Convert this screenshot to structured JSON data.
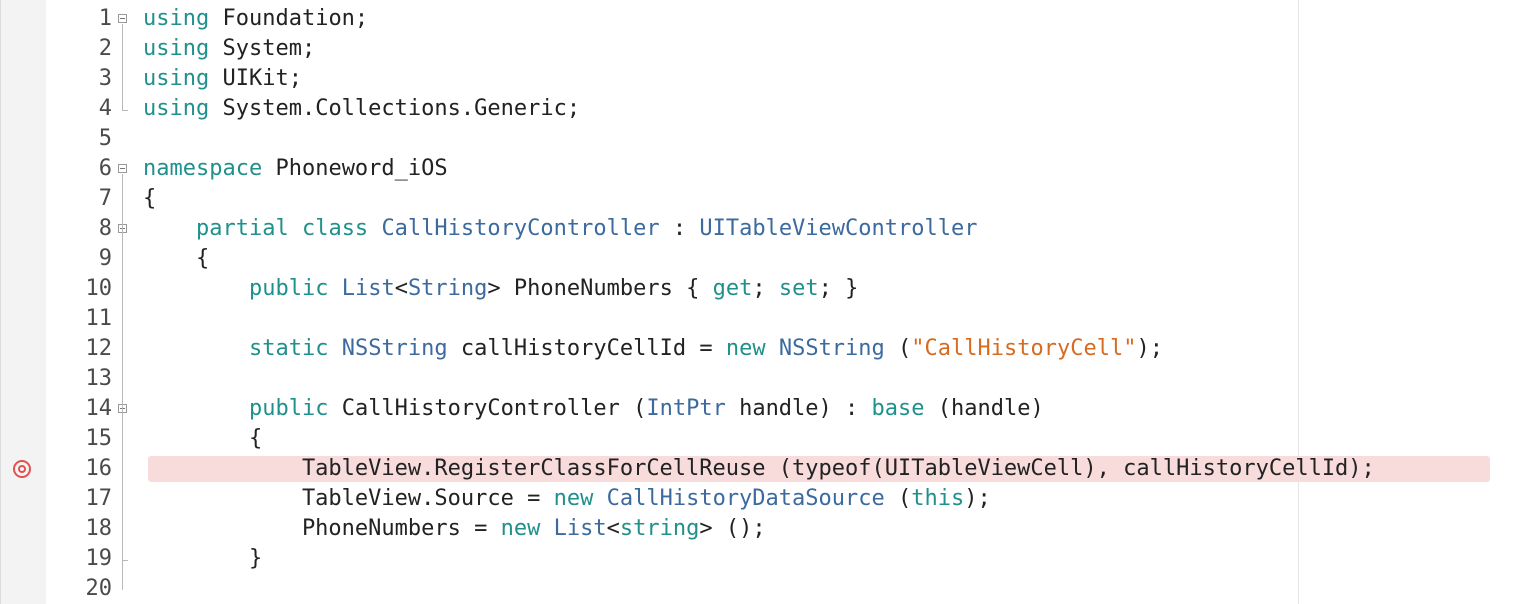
{
  "editor": {
    "language": "csharp",
    "colors": {
      "keyword": "#20908c",
      "type": "#3c6a9e",
      "string": "#d76b1f",
      "plain": "#222222",
      "highlight": "#f8dcdc",
      "breakpoint": "#e05252"
    },
    "breakpoint_line": 16,
    "highlighted_line": 16,
    "fold_markers": [
      1,
      6,
      8,
      14
    ],
    "lines": [
      {
        "n": "1",
        "tokens": [
          {
            "t": "using",
            "k": "kw"
          },
          {
            "t": " Foundation;",
            "k": "p"
          }
        ]
      },
      {
        "n": "2",
        "tokens": [
          {
            "t": "using",
            "k": "kw"
          },
          {
            "t": " System;",
            "k": "p"
          }
        ]
      },
      {
        "n": "3",
        "tokens": [
          {
            "t": "using",
            "k": "kw"
          },
          {
            "t": " UIKit;",
            "k": "p"
          }
        ]
      },
      {
        "n": "4",
        "tokens": [
          {
            "t": "using",
            "k": "kw"
          },
          {
            "t": " System.Collections.Generic;",
            "k": "p"
          }
        ]
      },
      {
        "n": "5",
        "tokens": []
      },
      {
        "n": "6",
        "tokens": [
          {
            "t": "namespace",
            "k": "kw"
          },
          {
            "t": " Phoneword_iOS",
            "k": "p"
          }
        ]
      },
      {
        "n": "7",
        "tokens": [
          {
            "t": "{",
            "k": "p"
          }
        ]
      },
      {
        "n": "8",
        "tokens": [
          {
            "t": "    ",
            "k": "p"
          },
          {
            "t": "partial",
            "k": "kw"
          },
          {
            "t": " ",
            "k": "p"
          },
          {
            "t": "class",
            "k": "kw"
          },
          {
            "t": " ",
            "k": "p"
          },
          {
            "t": "CallHistoryController",
            "k": "ty"
          },
          {
            "t": " : ",
            "k": "p"
          },
          {
            "t": "UITableViewController",
            "k": "ty"
          }
        ]
      },
      {
        "n": "9",
        "tokens": [
          {
            "t": "    {",
            "k": "p"
          }
        ]
      },
      {
        "n": "10",
        "tokens": [
          {
            "t": "        ",
            "k": "p"
          },
          {
            "t": "public",
            "k": "kw"
          },
          {
            "t": " ",
            "k": "p"
          },
          {
            "t": "List",
            "k": "ty"
          },
          {
            "t": "<",
            "k": "p"
          },
          {
            "t": "String",
            "k": "ty"
          },
          {
            "t": "> PhoneNumbers { ",
            "k": "p"
          },
          {
            "t": "get",
            "k": "kw"
          },
          {
            "t": "; ",
            "k": "p"
          },
          {
            "t": "set",
            "k": "kw"
          },
          {
            "t": "; }",
            "k": "p"
          }
        ]
      },
      {
        "n": "11",
        "tokens": []
      },
      {
        "n": "12",
        "tokens": [
          {
            "t": "        ",
            "k": "p"
          },
          {
            "t": "static",
            "k": "kw"
          },
          {
            "t": " ",
            "k": "p"
          },
          {
            "t": "NSString",
            "k": "ty"
          },
          {
            "t": " callHistoryCellId = ",
            "k": "p"
          },
          {
            "t": "new",
            "k": "kw"
          },
          {
            "t": " ",
            "k": "p"
          },
          {
            "t": "NSString",
            "k": "ty"
          },
          {
            "t": " (",
            "k": "p"
          },
          {
            "t": "\"CallHistoryCell\"",
            "k": "str"
          },
          {
            "t": ");",
            "k": "p"
          }
        ]
      },
      {
        "n": "13",
        "tokens": []
      },
      {
        "n": "14",
        "tokens": [
          {
            "t": "        ",
            "k": "p"
          },
          {
            "t": "public",
            "k": "kw"
          },
          {
            "t": " CallHistoryController (",
            "k": "p"
          },
          {
            "t": "IntPtr",
            "k": "ty"
          },
          {
            "t": " handle) : ",
            "k": "p"
          },
          {
            "t": "base",
            "k": "kw"
          },
          {
            "t": " (handle)",
            "k": "p"
          }
        ]
      },
      {
        "n": "15",
        "tokens": [
          {
            "t": "        {",
            "k": "p"
          }
        ]
      },
      {
        "n": "16",
        "tokens": [
          {
            "t": "            TableView.RegisterClassForCellReuse (typeof(UITableViewCell), callHistoryCellId);",
            "k": "p"
          }
        ]
      },
      {
        "n": "17",
        "tokens": [
          {
            "t": "            TableView.Source = ",
            "k": "p"
          },
          {
            "t": "new",
            "k": "kw"
          },
          {
            "t": " ",
            "k": "p"
          },
          {
            "t": "CallHistoryDataSource",
            "k": "ty"
          },
          {
            "t": " (",
            "k": "p"
          },
          {
            "t": "this",
            "k": "kw"
          },
          {
            "t": ");",
            "k": "p"
          }
        ]
      },
      {
        "n": "18",
        "tokens": [
          {
            "t": "            PhoneNumbers = ",
            "k": "p"
          },
          {
            "t": "new",
            "k": "kw"
          },
          {
            "t": " ",
            "k": "p"
          },
          {
            "t": "List",
            "k": "ty"
          },
          {
            "t": "<",
            "k": "p"
          },
          {
            "t": "string",
            "k": "kw"
          },
          {
            "t": "> ();",
            "k": "p"
          }
        ]
      },
      {
        "n": "19",
        "tokens": [
          {
            "t": "        }",
            "k": "p"
          }
        ]
      },
      {
        "n": "20",
        "tokens": []
      }
    ]
  }
}
